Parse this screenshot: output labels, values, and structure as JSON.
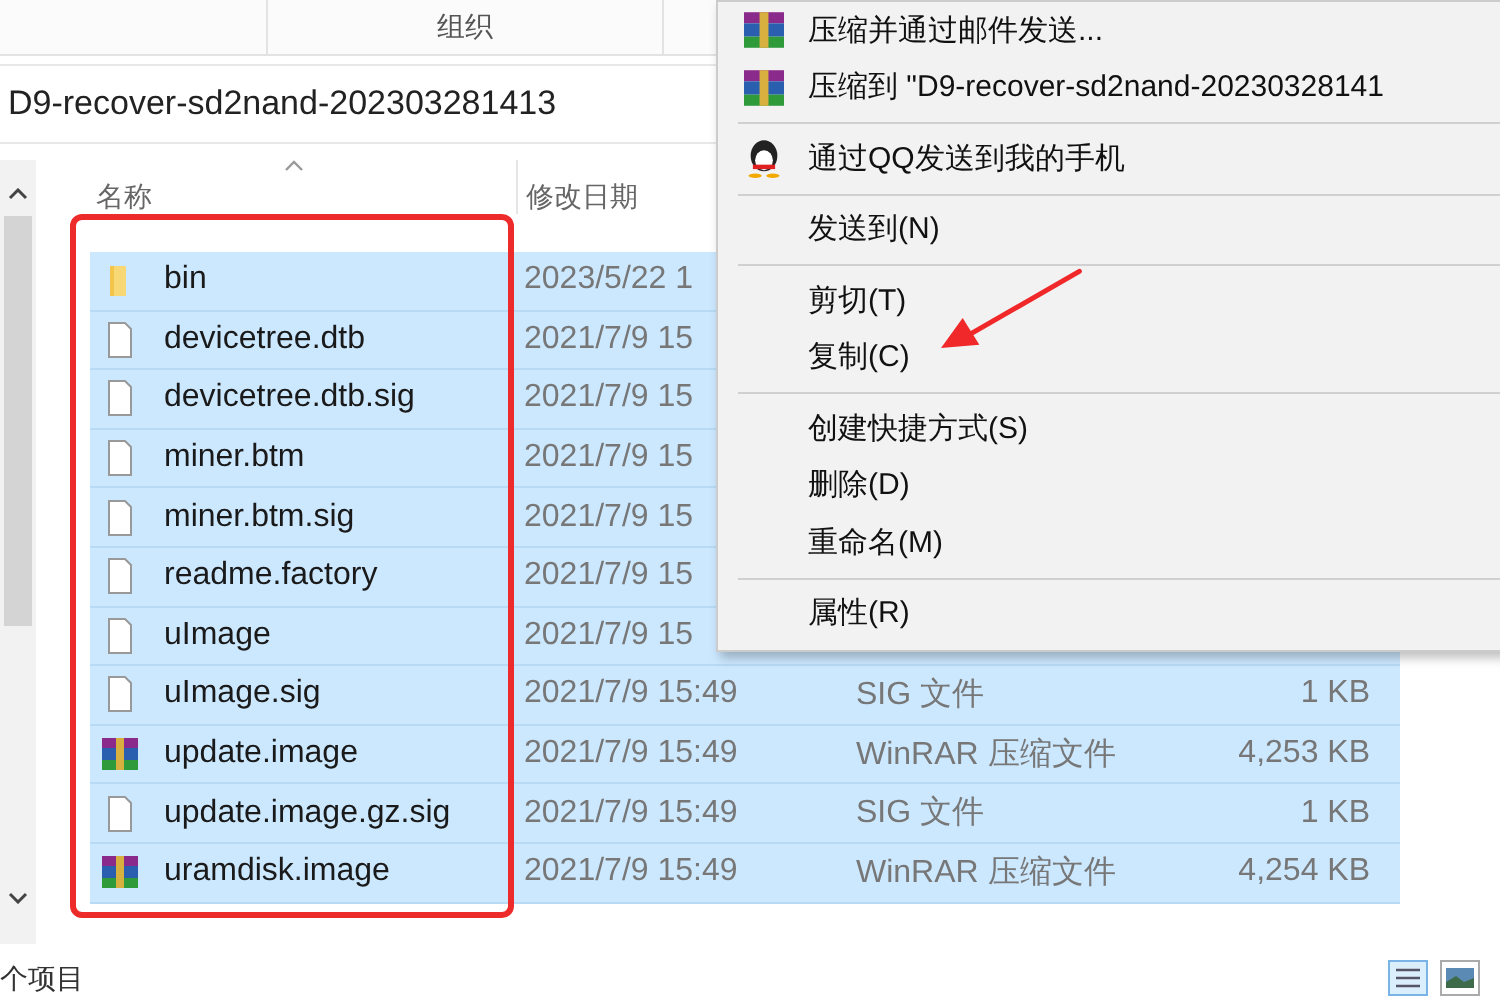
{
  "ribbon": {
    "group_label": "组织"
  },
  "address_bar": {
    "path": "D9-recover-sd2nand-202303281413"
  },
  "columns": [
    "名称",
    "修改日期"
  ],
  "files": [
    {
      "name": "bin",
      "kind": "folder",
      "date": "2023/5/22 1",
      "selected": true
    },
    {
      "name": "devicetree.dtb",
      "kind": "file",
      "date": "2021/7/9 15",
      "selected": true
    },
    {
      "name": "devicetree.dtb.sig",
      "kind": "file",
      "date": "2021/7/9 15",
      "selected": true
    },
    {
      "name": "miner.btm",
      "kind": "file",
      "date": "2021/7/9 15",
      "selected": true
    },
    {
      "name": "miner.btm.sig",
      "kind": "file",
      "date": "2021/7/9 15",
      "selected": true
    },
    {
      "name": "readme.factory",
      "kind": "file",
      "date": "2021/7/9 15",
      "selected": true
    },
    {
      "name": "uImage",
      "kind": "file",
      "date": "2021/7/9 15",
      "selected": true
    },
    {
      "name": "uImage.sig",
      "kind": "file",
      "date": "2021/7/9 15:49",
      "type": "SIG 文件",
      "size": "1 KB",
      "selected": true
    },
    {
      "name": "update.image",
      "kind": "archive",
      "date": "2021/7/9 15:49",
      "type": "WinRAR 压缩文件",
      "size": "4,253 KB",
      "selected": true
    },
    {
      "name": "update.image.gz.sig",
      "kind": "file",
      "date": "2021/7/9 15:49",
      "type": "SIG 文件",
      "size": "1 KB",
      "selected": true
    },
    {
      "name": "uramdisk.image",
      "kind": "archive",
      "date": "2021/7/9 15:49",
      "type": "WinRAR 压缩文件",
      "size": "4,254 KB",
      "selected": true
    }
  ],
  "status_bar": {
    "text": "个项目"
  },
  "context_menu": {
    "groups": [
      [
        {
          "label": "压缩并通过邮件发送...",
          "kind": "winrar"
        },
        {
          "label": "压缩到 \"D9-recover-sd2nand-20230328141",
          "kind": "winrar"
        }
      ],
      [
        {
          "label": "通过QQ发送到我的手机",
          "kind": "qq"
        }
      ],
      [
        {
          "label": "发送到(N)",
          "kind": "plain"
        }
      ],
      [
        {
          "label": "剪切(T)",
          "kind": "plain"
        },
        {
          "label": "复制(C)",
          "kind": "plain"
        }
      ],
      [
        {
          "label": "创建快捷方式(S)",
          "kind": "plain"
        },
        {
          "label": "删除(D)",
          "kind": "plain"
        },
        {
          "label": "重命名(M)",
          "kind": "plain"
        }
      ],
      [
        {
          "label": "属性(R)",
          "kind": "plain"
        }
      ]
    ]
  }
}
